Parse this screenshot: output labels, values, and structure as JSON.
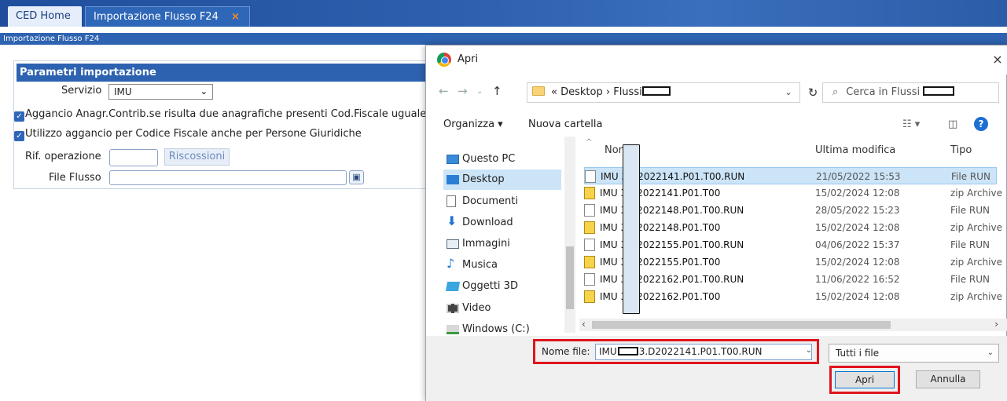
{
  "app": {
    "tabs": [
      {
        "label": "CED Home"
      },
      {
        "label": "Importazione Flusso F24",
        "close": "×"
      }
    ],
    "breadcrumb": "Importazione Flusso F24",
    "panel": {
      "title": "Parametri importazione",
      "servizio_label": "Servizio",
      "servizio_value": "IMU",
      "check1": "Aggancio Anagr.Contrib.se risulta due anagrafiche presenti Cod.Fiscale uguale",
      "check2": "Utilizzo aggancio per Codice Fiscale anche per Persone Giuridiche",
      "rif_label": "Rif. operazione",
      "riscossioni_btn": "Riscossioni",
      "file_label": "File Flusso"
    }
  },
  "dialog": {
    "title": "Apri",
    "close": "×",
    "address": {
      "prefix": "«",
      "path1": "Desktop",
      "sep": "›",
      "path2": "Flussi"
    },
    "search_placeholder": "Cerca in Flussi",
    "toolbar": {
      "organizza": "Organizza ▾",
      "nuova_cartella": "Nuova cartella"
    },
    "sidebar": [
      {
        "label": "Questo PC"
      },
      {
        "label": "Desktop"
      },
      {
        "label": "Documenti"
      },
      {
        "label": "Download"
      },
      {
        "label": "Immagini"
      },
      {
        "label": "Musica"
      },
      {
        "label": "Oggetti 3D"
      },
      {
        "label": "Video"
      },
      {
        "label": "Windows (C:)"
      }
    ],
    "columns": {
      "name": "Nome",
      "date": "Ultima modifica",
      "type": "Tipo"
    },
    "files": [
      {
        "name": "IMU       3.D2022141.P01.T00.RUN",
        "date": "21/05/2022 15:53",
        "type": "File RUN",
        "icon": "doc"
      },
      {
        "name": "IMU       3.D2022141.P01.T00",
        "date": "15/02/2024 12:08",
        "type": "zip Archive",
        "icon": "zip"
      },
      {
        "name": "IMU       3.D2022148.P01.T00.RUN",
        "date": "28/05/2022 15:23",
        "type": "File RUN",
        "icon": "doc"
      },
      {
        "name": "IMU       3.D2022148.P01.T00",
        "date": "15/02/2024 12:08",
        "type": "zip Archive",
        "icon": "zip"
      },
      {
        "name": "IMU       3.D2022155.P01.T00.RUN",
        "date": "04/06/2022 15:37",
        "type": "File RUN",
        "icon": "doc"
      },
      {
        "name": "IMU       3.D2022155.P01.T00",
        "date": "15/02/2024 12:08",
        "type": "zip Archive",
        "icon": "zip"
      },
      {
        "name": "IMU       3.D2022162.P01.T00.RUN",
        "date": "11/06/2022 16:52",
        "type": "File RUN",
        "icon": "doc"
      },
      {
        "name": "IMU       3.D2022162.P01.T00",
        "date": "15/02/2024 12:08",
        "type": "zip Archive",
        "icon": "zip"
      }
    ],
    "filename_label": "Nome file:",
    "filename_prefix": "IMU",
    "filename_suffix": "3.D2022141.P01.T00.RUN",
    "filetype": "Tutti i file",
    "open_btn": "Apri",
    "cancel_btn": "Annulla",
    "accent_color": "#e0141e"
  }
}
